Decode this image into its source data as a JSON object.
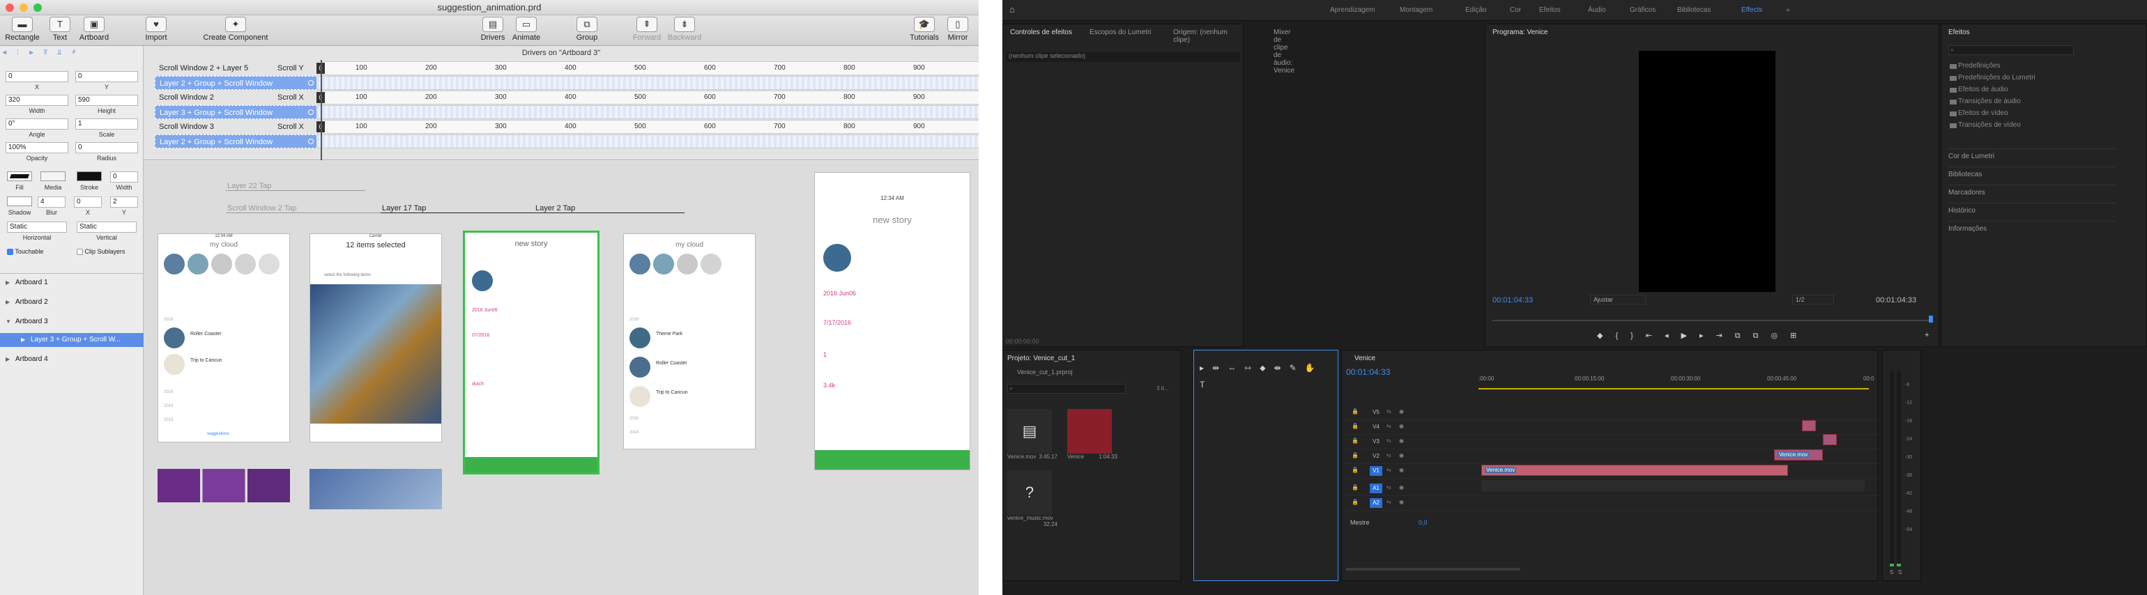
{
  "mac": {
    "title": "suggestion_animation.prd",
    "toolbar": {
      "rectangle": "Rectangle",
      "text": "Text",
      "artboard": "Artboard",
      "import": "Import",
      "create_component": "Create Component",
      "drivers": "Drivers",
      "animate": "Animate",
      "group": "Group",
      "forward": "Forward",
      "backward": "Backward",
      "tutorials": "Tutorials",
      "mirror": "Mirror"
    },
    "inspector": {
      "x": "0",
      "y": "0",
      "x_label": "X",
      "y_label": "Y",
      "width": "320",
      "height": "590",
      "width_label": "Width",
      "height_label": "Height",
      "angle": "0°",
      "scale": "1",
      "angle_label": "Angle",
      "scale_label": "Scale",
      "opacity": "100%",
      "radius": "0",
      "opacity_label": "Opacity",
      "radius_label": "Radius",
      "fill_label": "Fill",
      "media_label": "Media",
      "stroke_label": "Stroke",
      "stroke_width": "0",
      "width_label2": "Width",
      "shadow_label": "Shadow",
      "blur_label": "Blur",
      "sx_label": "X",
      "sy_label": "Y",
      "blur": "4",
      "sx": "0",
      "sy": "2",
      "horizontal": "Static",
      "vertical": "Static",
      "horizontal_label": "Horizontal",
      "vertical_label": "Vertical",
      "touchable": "Touchable",
      "clip": "Clip Sublayers"
    },
    "layers": [
      {
        "label": "Artboard 1"
      },
      {
        "label": "Artboard 2"
      },
      {
        "label": "Artboard 3"
      },
      {
        "label": "Layer 3 + Group + Scroll W..."
      },
      {
        "label": "Artboard 4"
      }
    ],
    "timeline": {
      "header": "Drivers on \"Artboard 3\"",
      "ticks": [
        "100",
        "200",
        "300",
        "400",
        "500",
        "600",
        "700",
        "800",
        "900"
      ],
      "zero": "0",
      "rows": [
        {
          "name": "Scroll Window 2 + Layer 5",
          "prop": "Scroll Y"
        },
        {
          "name": "Layer 2 + Group + Scroll Window",
          "prop": ""
        },
        {
          "name": "Scroll Window 2",
          "prop": "Scroll X"
        },
        {
          "name": "Layer 3 + Group + Scroll Window",
          "prop": ""
        },
        {
          "name": "Scroll Window 3",
          "prop": "Scroll X"
        },
        {
          "name": "Layer 2 + Group + Scroll Window",
          "prop": ""
        }
      ]
    },
    "canvas": {
      "arrows": [
        "Layer 22 Tap",
        "Scroll Window 2 Tap",
        "Layer 17 Tap",
        "Layer 2 Tap"
      ],
      "phones": [
        {
          "title": "my cloud",
          "rows": [
            "Roller Coaster",
            "Trip to Cancun"
          ],
          "years": [
            "2016",
            "2015",
            "2014",
            "2013"
          ],
          "suggest": "suggestions"
        },
        {
          "title": "12 items selected",
          "hint": "select the following items"
        },
        {
          "title": "new story",
          "fields": [
            "2016 Jun06",
            "07/2016",
            "dutch"
          ]
        },
        {
          "title": "my cloud",
          "rows": [
            "Theme Park",
            "Roller Coaster",
            "Trip to Cancun"
          ],
          "years": [
            "2016",
            "2015",
            "2014"
          ]
        },
        {
          "title": "new story",
          "fields": [
            "2016 Jun06",
            "7/17/2016",
            "1",
            "3.4k"
          ]
        }
      ],
      "status_time": "12:34 AM",
      "carrier": "Carrier",
      "battery": "100%"
    }
  },
  "premiere": {
    "workspaces": [
      "Aprendizagem",
      "Montagem",
      "Edição",
      "Cor",
      "Efeitos",
      "Áudio",
      "Gráficos",
      "Bibliotecas",
      "Effects"
    ],
    "active_workspace": "Effects",
    "more": "»",
    "source_tabs": [
      "Controles de efeitos",
      "Escopos do Lumetri",
      "Origem: (nenhum clipe)",
      "Mixer de clipe de áudio: Venice"
    ],
    "no_clip": "(nenhum clipe selecionado)",
    "source_tc": "00:00:00:00",
    "program_tab": "Programa: Venice",
    "program_tc": "00:01:04:33",
    "fit": "Ajustar",
    "ratio": "1/2",
    "program_dur": "00:01:04:33",
    "effects_tab": "Efeitos",
    "effects": [
      "Predefinições",
      "Predefinições do Lumetri",
      "Efeitos de áudio",
      "Transições de áudio",
      "Efeitos de vídeo",
      "Transições de vídeo"
    ],
    "sections": [
      "Cor de Lumetri",
      "Bibliotecas",
      "Marcadores",
      "Histórico",
      "Informações"
    ],
    "project_tab": "Projeto: Venice_cut_1",
    "project_file": "Venice_cut_1.prproj",
    "items_count": "3 it...",
    "bin": [
      {
        "name": "Venice.mov",
        "dur": "3:45:17"
      },
      {
        "name": "Venice",
        "dur": "1:04:33"
      },
      {
        "name": "venice_music.mov",
        "dur": "32:24"
      }
    ],
    "sequence_tab": "Venice",
    "seq_tc": "00:01:04:33",
    "ruler": [
      ":00:00",
      "00:00:15:00",
      "00:00:30:00",
      "00:00:45:00",
      "00:0"
    ],
    "tracks": [
      "V5",
      "V4",
      "V3",
      "V2",
      "V1",
      "A1",
      "A2"
    ],
    "master": "Mestre",
    "master_val": "0,0",
    "clip_label": "Venice.mov",
    "meter_ticks": [
      "-6",
      "-12",
      "-18",
      "-24",
      "-30",
      "-36",
      "-42",
      "-48",
      "-54"
    ],
    "meter_s": "S",
    "colors": {
      "accent": "#3c8ef0",
      "clip": "#c06070",
      "green": "#3cb14a",
      "select": "#5b8de6"
    }
  }
}
